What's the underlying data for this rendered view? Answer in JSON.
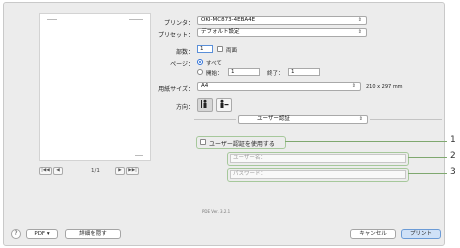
{
  "preview": {
    "page_indicator": "1/1",
    "nav": {
      "first": "|◀◀",
      "prev": "◀",
      "next": "▶",
      "last": "▶▶|"
    }
  },
  "form": {
    "printer_label": "プリンタ：",
    "printer_value": "OKI-MC873-4EBA4E",
    "preset_label": "プリセット：",
    "preset_value": "デフォルト設定",
    "copies_label": "部数：",
    "copies_value": "1",
    "duplex_label": "両面",
    "pages_label": "ページ：",
    "pages_all": "すべて",
    "pages_from": "開始：",
    "pages_from_value": "1",
    "pages_to": "終了：",
    "pages_to_value": "1",
    "paper_label": "用紙サイズ：",
    "paper_value": "A4",
    "paper_dims": "210 x 297 mm",
    "orientation_label": "方向：",
    "section_popup": "ユーザー認証",
    "use_auth_label": "ユーザー認証を使用する",
    "username_placeholder": "ユーザー名：",
    "password_placeholder": "パスワード："
  },
  "callouts": [
    "1",
    "2",
    "3"
  ],
  "pde_version": "PDE Ver. 3.2.1",
  "bottom": {
    "help": "?",
    "pdf": "PDF ▾",
    "hide_details": "詳細を隠す",
    "cancel": "キャンセル",
    "print": "プリント"
  },
  "colors": {
    "accent": "#2f71d8",
    "highlight_border": "#a6c89b",
    "primary_button": "#cfe1f7"
  },
  "icons": {
    "portrait": "portrait-orientation-icon",
    "landscape": "landscape-orientation-icon"
  }
}
